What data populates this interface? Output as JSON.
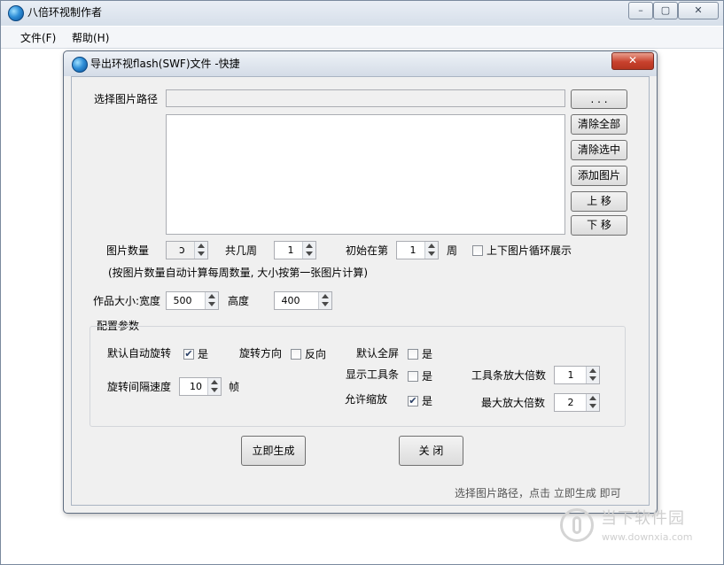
{
  "app": {
    "title": "八倍环视制作者",
    "window_controls": [
      "–",
      "▢",
      "✕"
    ]
  },
  "menu": {
    "file": "文件(F)",
    "help": "帮助(H)"
  },
  "dialog": {
    "title": "导出环视flash(SWF)文件 -快捷",
    "close": "✕",
    "path_label": "选择图片路径",
    "path_value": "",
    "browse_label": ". . .",
    "buttons": {
      "clear_all": "清除全部",
      "clear_selected": "清除选中",
      "add_images": "添加图片",
      "move_up": "上 移",
      "move_down": "下 移"
    },
    "image_count_label": "图片数量",
    "image_count_value": "",
    "weeks_label": "共几周",
    "weeks_value": "1",
    "start_label": "初始在第",
    "start_value": "1",
    "start_unit": "周",
    "loop_label": "上下图片循环展示",
    "loop_checked": false,
    "hint": "(按图片数量自动计算每周数量, 大小按第一张图片计算)",
    "size_label": "作品大小:宽度",
    "width_value": "500",
    "height_label": "高度",
    "height_value": "400",
    "config_title": "配置参数",
    "config": {
      "auto_rotate_label": "默认自动旋转",
      "auto_rotate_checked": true,
      "auto_rotate_text": "是",
      "direction_label": "旋转方向",
      "reverse_checked": false,
      "reverse_text": "反向",
      "fullscreen_label": "默认全屏",
      "fullscreen_checked": false,
      "fullscreen_text": "是",
      "toolbar_label": "显示工具条",
      "toolbar_checked": false,
      "toolbar_text": "是",
      "zoom_label": "允许缩放",
      "zoom_checked": true,
      "zoom_text": "是",
      "interval_label": "旋转间隔速度",
      "interval_value": "10",
      "interval_unit": "帧",
      "toolbar_zoom_label": "工具条放大倍数",
      "toolbar_zoom_value": "1",
      "max_zoom_label": "最大放大倍数",
      "max_zoom_value": "2"
    },
    "generate_label": "立即生成",
    "close_label": "关 闭",
    "status": "选择图片路径，点击 立即生成 即可"
  },
  "watermark": {
    "cn": "当下软件园",
    "url": "www.downxia.com"
  },
  "colors": {
    "dialog_bg": "#f0f0f0",
    "close_red": "#c8412d",
    "title_gradient_top": "#eef2f7"
  }
}
